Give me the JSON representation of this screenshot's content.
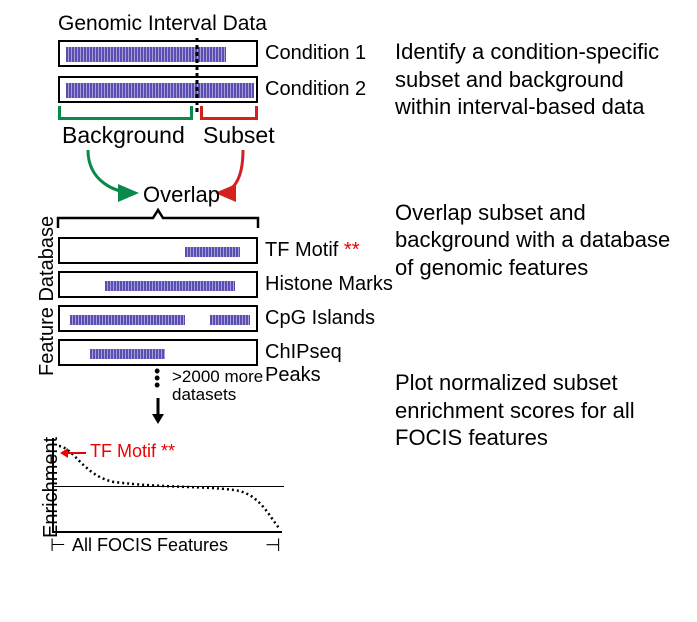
{
  "section1": {
    "title": "Genomic Interval Data",
    "track1_label": "Condition 1",
    "track2_label": "Condition 2",
    "background_label": "Background",
    "subset_label": "Subset",
    "desc": "Identify a condition-specific subset and background within interval-based data"
  },
  "section2": {
    "overlap_label": "Overlap",
    "side_label": "Feature Database",
    "tracks": [
      {
        "label": "TF Motif",
        "star": "**"
      },
      {
        "label": "Histone Marks",
        "star": ""
      },
      {
        "label": "CpG Islands",
        "star": ""
      },
      {
        "label": "ChIPseq Peaks",
        "star": ""
      }
    ],
    "more_label": ">2000 more",
    "more_label2": "datasets",
    "desc": "Overlap subset and background with a database of genomic features"
  },
  "section3": {
    "side_label": "Enrichment",
    "tf_anno": "TF Motif **",
    "x_label": "All FOCIS Features",
    "desc": "Plot normalized subset enrichment scores for all FOCIS features"
  }
}
